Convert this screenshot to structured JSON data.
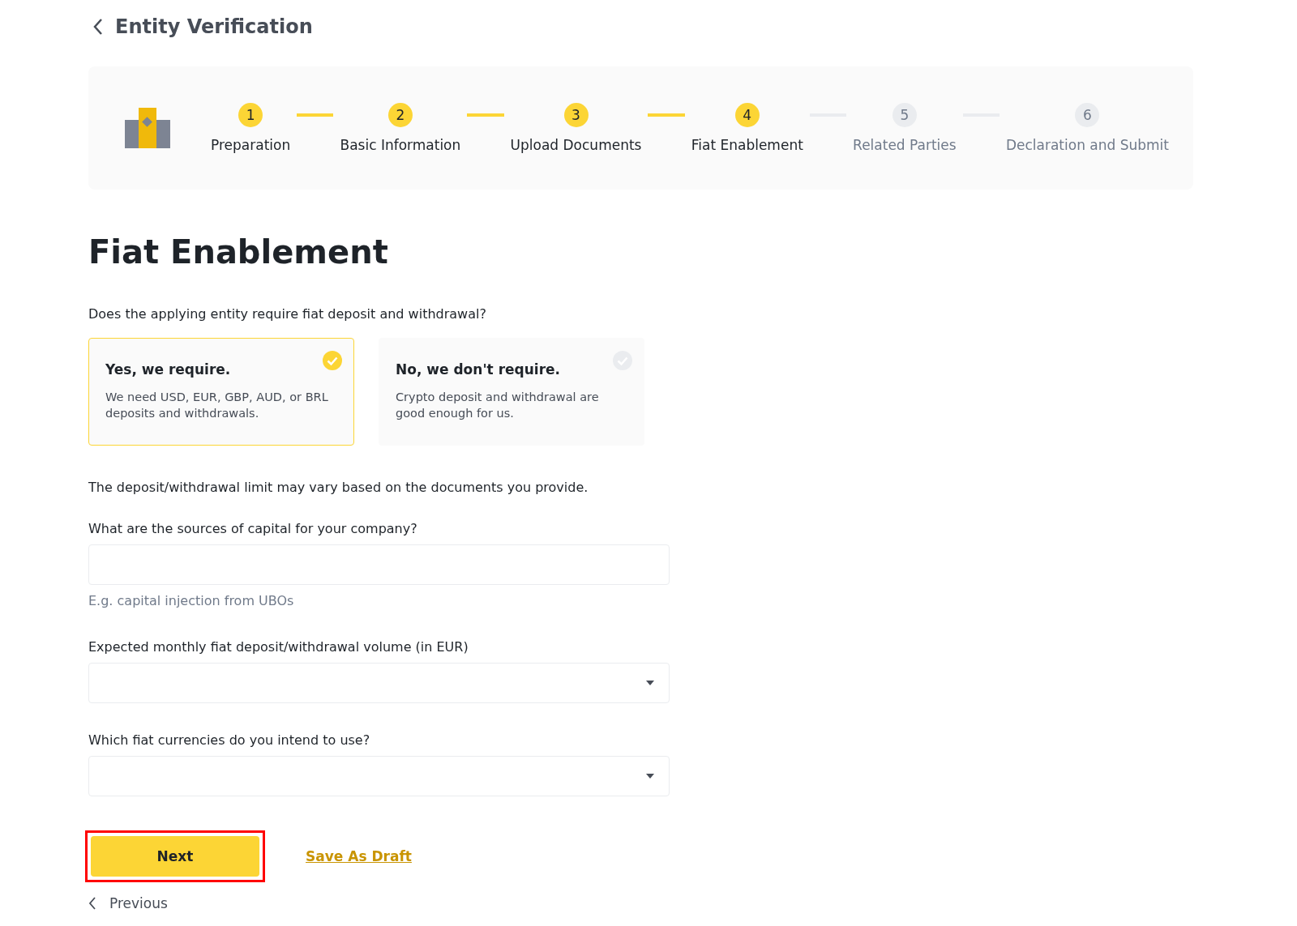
{
  "header": {
    "title": "Entity Verification"
  },
  "steps": [
    {
      "number": "1",
      "label": "Preparation",
      "reached": true
    },
    {
      "number": "2",
      "label": "Basic Information",
      "reached": true
    },
    {
      "number": "3",
      "label": "Upload Documents",
      "reached": true
    },
    {
      "number": "4",
      "label": "Fiat Enablement",
      "reached": true
    },
    {
      "number": "5",
      "label": "Related Parties",
      "reached": false
    },
    {
      "number": "6",
      "label": "Declaration and Submit",
      "reached": false
    }
  ],
  "page_title": "Fiat Enablement",
  "question": "Does the applying entity require fiat deposit and withdrawal?",
  "options": [
    {
      "title": "Yes, we require.",
      "description": "We need USD, EUR, GBP, AUD, or BRL deposits and withdrawals.",
      "selected": true
    },
    {
      "title": "No, we don't require.",
      "description": "Crypto deposit and withdrawal are good enough for us.",
      "selected": false
    }
  ],
  "note": "The deposit/withdrawal limit may vary based on the documents you provide.",
  "fields": [
    {
      "kind": "text",
      "label": "What are the sources of capital for your company?",
      "hint": "E.g. capital injection from UBOs"
    },
    {
      "kind": "select",
      "label": "Expected monthly fiat deposit/withdrawal volume (in EUR)"
    },
    {
      "kind": "select",
      "label": "Which fiat currencies do you intend to use?"
    }
  ],
  "actions": {
    "next": {
      "label": "Next",
      "highlighted": true
    },
    "draft": "Save As Draft",
    "previous": "Previous"
  }
}
